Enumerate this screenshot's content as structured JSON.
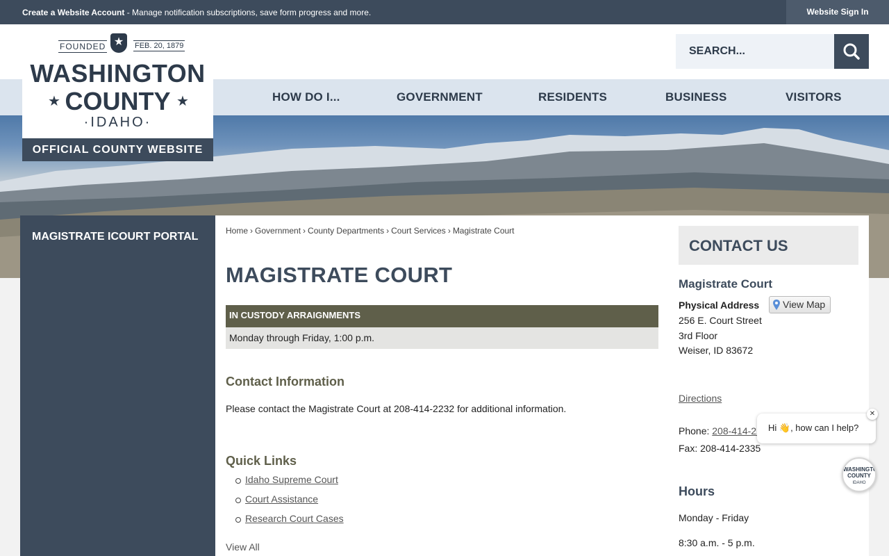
{
  "topbar": {
    "account_link": "Create a Website Account",
    "account_desc": " - Manage notification subscriptions, save form progress and more.",
    "signin": "Website Sign In"
  },
  "logo": {
    "founded": "FOUNDED",
    "date": "FEB. 20, 1879",
    "line1": "WASHINGTON",
    "line2": "COUNTY",
    "state": "IDAHO",
    "tagline": "OFFICIAL COUNTY WEBSITE"
  },
  "search": {
    "placeholder": "SEARCH..."
  },
  "nav": [
    "HOW DO I...",
    "GOVERNMENT",
    "RESIDENTS",
    "BUSINESS",
    "VISITORS"
  ],
  "sidebar": {
    "items": [
      "MAGISTRATE ICOURT PORTAL"
    ]
  },
  "breadcrumb": [
    "Home",
    "Government",
    "County Departments",
    "Court Services",
    "Magistrate Court"
  ],
  "breadcrumb_sep": "›",
  "page": {
    "title": "MAGISTRATE COURT",
    "table_header": "IN CUSTODY ARRAIGNMENTS",
    "table_row": "Monday through Friday, 1:00 p.m.",
    "contact_heading": "Contact Information",
    "contact_text": "Please contact the Magistrate Court at 208-414-2232 for additional information.",
    "quick_links_heading": "Quick Links",
    "quick_links": [
      "Idaho Supreme Court",
      "Court Assistance",
      "Research Court Cases"
    ],
    "view_all": "View All"
  },
  "contact": {
    "heading": "CONTACT US",
    "name": "Magistrate Court",
    "address_label": "Physical Address",
    "view_map": "View Map",
    "address": [
      "256 E. Court Street",
      "3rd Floor",
      "Weiser, ID 83672"
    ],
    "directions": "Directions",
    "phone_label": "Phone: ",
    "phone": "208-414-2232",
    "fax": "Fax: 208-414-2335",
    "hours_heading": "Hours",
    "hours_days": "Monday - Friday",
    "hours_time": "8:30 a.m. - 5 p.m."
  },
  "chat": {
    "greeting": "Hi 👋, how can I help?",
    "close": "✕",
    "avatar_line1": "WASHINGTON",
    "avatar_line2": "COUNTY",
    "avatar_line3": "IDAHO"
  },
  "colors": {
    "primary": "#3d4b5c",
    "nav_bg": "#dbe4ee",
    "table_header": "#5f5f4a"
  }
}
